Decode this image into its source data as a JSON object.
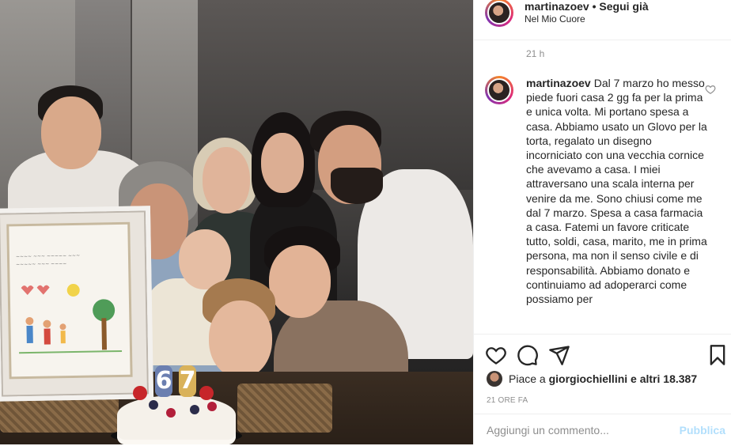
{
  "post": {
    "author": "martinazoev",
    "separator": "•",
    "follow_status": "Segui già",
    "location": "Nel Mio Cuore",
    "posted_ago": "21 h",
    "caption": "Dal 7 marzo ho messo piede fuori casa 2 gg fa per la prima e unica volta. Mi portano spesa a casa. Abbiamo usato un Glovo per la torta, regalato un disegno incorniciato con una vecchia cornice che avevamo a casa. I miei attraversano una scala interna per venire da me. Sono chiusi come me dal 7 marzo. Spesa a casa farmacia a casa. Fatemi un favore criticate tutto, soldi, casa, marito, me in prima persona, ma non il senso civile e di responsabilità. Abbiamo donato e continuiamo ad adoperarci come possiamo per"
  },
  "likes": {
    "prefix": "Piace a",
    "liker": "giorgiochiellini",
    "suffix": "e altri 18.387"
  },
  "date_label": "21 ORE FA",
  "add_comment": {
    "placeholder": "Aggiungi un commento...",
    "publish_label": "Pubblica"
  },
  "photo": {
    "cake_candles": [
      "6",
      "7"
    ]
  },
  "icons": {
    "like": "heart-icon",
    "comment": "comment-icon",
    "share": "send-icon",
    "save": "bookmark-icon",
    "comment_like": "heart-small-icon"
  },
  "colors": {
    "text": "#262626",
    "muted": "#8e8e8e",
    "publish_disabled": "#b2dffc",
    "divider": "#efefef"
  }
}
